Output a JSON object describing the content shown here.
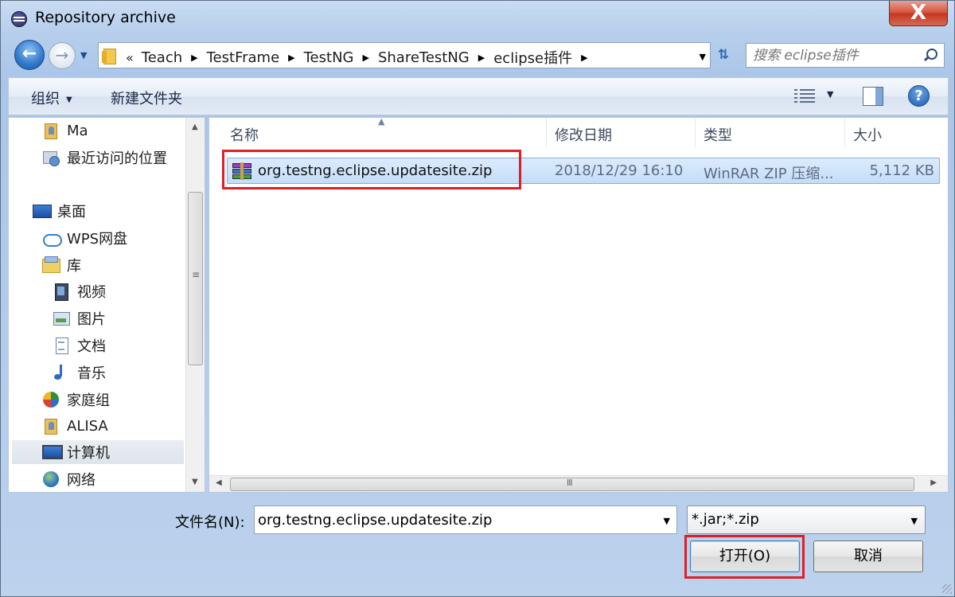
{
  "window": {
    "title": "Repository archive",
    "close_label": "X"
  },
  "nav": {
    "back_label": "←",
    "forward_label": "→",
    "breadcrumb": [
      "Teach",
      "TestFrame",
      "TestNG",
      "ShareTestNG",
      "eclipse插件"
    ],
    "breadcrumb_lead": "«"
  },
  "search": {
    "placeholder": "搜索 eclipse插件"
  },
  "toolbar": {
    "organize_label": "组织",
    "new_folder_label": "新建文件夹",
    "help_label": "?"
  },
  "sidebar": {
    "items": [
      {
        "label": "Ma",
        "icon": "user-folder-icon"
      },
      {
        "label": "最近访问的位置",
        "icon": "recent-places-icon"
      },
      {
        "label": "桌面",
        "icon": "desktop-icon"
      },
      {
        "label": "WPS网盘",
        "icon": "cloud-icon"
      },
      {
        "label": "库",
        "icon": "library-icon"
      },
      {
        "label": "视频",
        "icon": "video-icon"
      },
      {
        "label": "图片",
        "icon": "pictures-icon"
      },
      {
        "label": "文档",
        "icon": "documents-icon"
      },
      {
        "label": "音乐",
        "icon": "music-icon"
      },
      {
        "label": "家庭组",
        "icon": "homegroup-icon"
      },
      {
        "label": "ALISA",
        "icon": "user-folder-icon"
      },
      {
        "label": "计算机",
        "icon": "computer-icon"
      },
      {
        "label": "网络",
        "icon": "network-icon"
      }
    ]
  },
  "files": {
    "columns": [
      "名称",
      "修改日期",
      "类型",
      "大小"
    ],
    "rows": [
      {
        "name": "org.testng.eclipse.updatesite.zip",
        "date": "2018/12/29 16:10",
        "type": "WinRAR ZIP 压缩...",
        "size": "5,112 KB"
      }
    ]
  },
  "footer": {
    "filename_label": "文件名(N):",
    "filename_value": "org.testng.eclipse.updatesite.zip",
    "filetype_value": "*.jar;*.zip",
    "open_label": "打开(O)",
    "cancel_label": "取消"
  },
  "colors": {
    "highlight": "#e01e26",
    "selection": "#c4ddf8",
    "accent": "#2f77c9"
  }
}
